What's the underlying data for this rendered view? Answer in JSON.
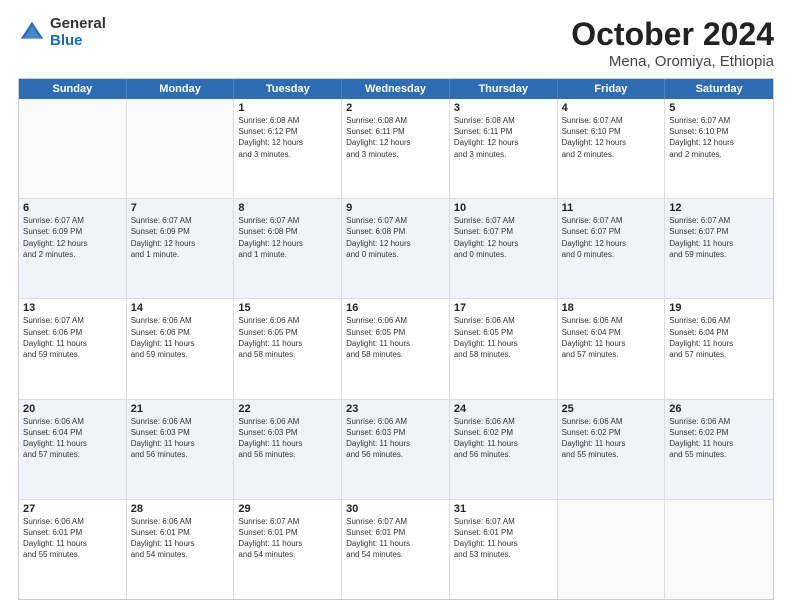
{
  "logo": {
    "general": "General",
    "blue": "Blue"
  },
  "title": "October 2024",
  "subtitle": "Mena, Oromiya, Ethiopia",
  "days": [
    "Sunday",
    "Monday",
    "Tuesday",
    "Wednesday",
    "Thursday",
    "Friday",
    "Saturday"
  ],
  "weeks": [
    [
      {
        "day": "",
        "info": ""
      },
      {
        "day": "",
        "info": ""
      },
      {
        "day": "1",
        "info": "Sunrise: 6:08 AM\nSunset: 6:12 PM\nDaylight: 12 hours\nand 3 minutes."
      },
      {
        "day": "2",
        "info": "Sunrise: 6:08 AM\nSunset: 6:11 PM\nDaylight: 12 hours\nand 3 minutes."
      },
      {
        "day": "3",
        "info": "Sunrise: 6:08 AM\nSunset: 6:11 PM\nDaylight: 12 hours\nand 3 minutes."
      },
      {
        "day": "4",
        "info": "Sunrise: 6:07 AM\nSunset: 6:10 PM\nDaylight: 12 hours\nand 2 minutes."
      },
      {
        "day": "5",
        "info": "Sunrise: 6:07 AM\nSunset: 6:10 PM\nDaylight: 12 hours\nand 2 minutes."
      }
    ],
    [
      {
        "day": "6",
        "info": "Sunrise: 6:07 AM\nSunset: 6:09 PM\nDaylight: 12 hours\nand 2 minutes."
      },
      {
        "day": "7",
        "info": "Sunrise: 6:07 AM\nSunset: 6:09 PM\nDaylight: 12 hours\nand 1 minute."
      },
      {
        "day": "8",
        "info": "Sunrise: 6:07 AM\nSunset: 6:08 PM\nDaylight: 12 hours\nand 1 minute."
      },
      {
        "day": "9",
        "info": "Sunrise: 6:07 AM\nSunset: 6:08 PM\nDaylight: 12 hours\nand 0 minutes."
      },
      {
        "day": "10",
        "info": "Sunrise: 6:07 AM\nSunset: 6:07 PM\nDaylight: 12 hours\nand 0 minutes."
      },
      {
        "day": "11",
        "info": "Sunrise: 6:07 AM\nSunset: 6:07 PM\nDaylight: 12 hours\nand 0 minutes."
      },
      {
        "day": "12",
        "info": "Sunrise: 6:07 AM\nSunset: 6:07 PM\nDaylight: 11 hours\nand 59 minutes."
      }
    ],
    [
      {
        "day": "13",
        "info": "Sunrise: 6:07 AM\nSunset: 6:06 PM\nDaylight: 11 hours\nand 59 minutes."
      },
      {
        "day": "14",
        "info": "Sunrise: 6:06 AM\nSunset: 6:06 PM\nDaylight: 11 hours\nand 59 minutes."
      },
      {
        "day": "15",
        "info": "Sunrise: 6:06 AM\nSunset: 6:05 PM\nDaylight: 11 hours\nand 58 minutes."
      },
      {
        "day": "16",
        "info": "Sunrise: 6:06 AM\nSunset: 6:05 PM\nDaylight: 11 hours\nand 58 minutes."
      },
      {
        "day": "17",
        "info": "Sunrise: 6:06 AM\nSunset: 6:05 PM\nDaylight: 11 hours\nand 58 minutes."
      },
      {
        "day": "18",
        "info": "Sunrise: 6:06 AM\nSunset: 6:04 PM\nDaylight: 11 hours\nand 57 minutes."
      },
      {
        "day": "19",
        "info": "Sunrise: 6:06 AM\nSunset: 6:04 PM\nDaylight: 11 hours\nand 57 minutes."
      }
    ],
    [
      {
        "day": "20",
        "info": "Sunrise: 6:06 AM\nSunset: 6:04 PM\nDaylight: 11 hours\nand 57 minutes."
      },
      {
        "day": "21",
        "info": "Sunrise: 6:06 AM\nSunset: 6:03 PM\nDaylight: 11 hours\nand 56 minutes."
      },
      {
        "day": "22",
        "info": "Sunrise: 6:06 AM\nSunset: 6:03 PM\nDaylight: 11 hours\nand 56 minutes."
      },
      {
        "day": "23",
        "info": "Sunrise: 6:06 AM\nSunset: 6:03 PM\nDaylight: 11 hours\nand 56 minutes."
      },
      {
        "day": "24",
        "info": "Sunrise: 6:06 AM\nSunset: 6:02 PM\nDaylight: 11 hours\nand 56 minutes."
      },
      {
        "day": "25",
        "info": "Sunrise: 6:06 AM\nSunset: 6:02 PM\nDaylight: 11 hours\nand 55 minutes."
      },
      {
        "day": "26",
        "info": "Sunrise: 6:06 AM\nSunset: 6:02 PM\nDaylight: 11 hours\nand 55 minutes."
      }
    ],
    [
      {
        "day": "27",
        "info": "Sunrise: 6:06 AM\nSunset: 6:01 PM\nDaylight: 11 hours\nand 55 minutes."
      },
      {
        "day": "28",
        "info": "Sunrise: 6:06 AM\nSunset: 6:01 PM\nDaylight: 11 hours\nand 54 minutes."
      },
      {
        "day": "29",
        "info": "Sunrise: 6:07 AM\nSunset: 6:01 PM\nDaylight: 11 hours\nand 54 minutes."
      },
      {
        "day": "30",
        "info": "Sunrise: 6:07 AM\nSunset: 6:01 PM\nDaylight: 11 hours\nand 54 minutes."
      },
      {
        "day": "31",
        "info": "Sunrise: 6:07 AM\nSunset: 6:01 PM\nDaylight: 11 hours\nand 53 minutes."
      },
      {
        "day": "",
        "info": ""
      },
      {
        "day": "",
        "info": ""
      }
    ]
  ]
}
